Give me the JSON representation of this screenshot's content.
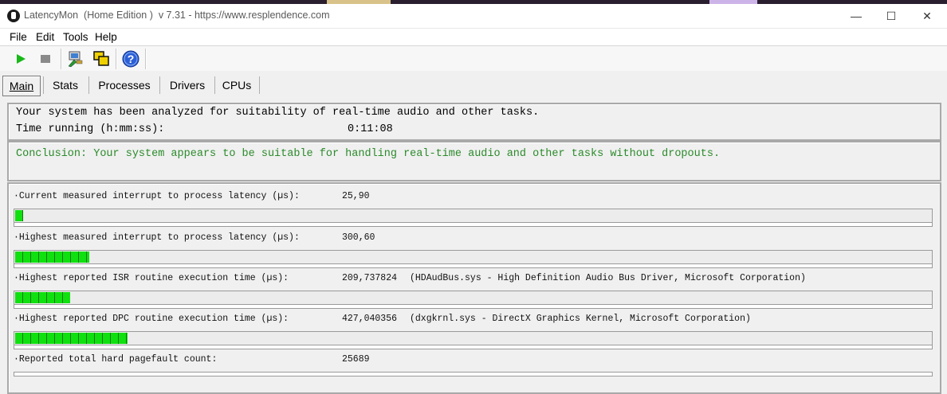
{
  "window": {
    "title": "LatencyMon  (Home Edition )  v 7.31 - https://www.resplendence.com",
    "minimize_glyph": "—",
    "maximize_glyph": "☐",
    "close_glyph": "✕"
  },
  "menu": [
    "File",
    "Edit",
    "Tools",
    "Help"
  ],
  "toolbar": {
    "icons": [
      "play-icon",
      "stop-icon",
      "options-icon",
      "windows-icon",
      "help-icon"
    ]
  },
  "tabs": [
    "Main",
    "Stats",
    "Processes",
    "Drivers",
    "CPUs"
  ],
  "active_tab": "Main",
  "summary": {
    "analysis_text": "Your system has been analyzed for suitability of real-time audio and other tasks.",
    "time_label": "Time running (h:mm:ss):",
    "time_value": "0:11:08"
  },
  "conclusion": "Conclusion: Your system appears to be suitable for handling real-time audio and other tasks without dropouts.",
  "colors": {
    "conclusion_text": "#2b8a2b",
    "bar_fill": "#10e010",
    "bar_segment_separator": "#0a7a0a"
  },
  "metrics": [
    {
      "label": "·Current measured interrupt to process latency (µs):",
      "value": "25,90",
      "extra": "",
      "bar_fraction": 0.0087
    },
    {
      "label": "·Highest measured interrupt to process latency (µs):",
      "value": "300,60",
      "extra": "",
      "bar_fraction": 0.081
    },
    {
      "label": "·Highest reported ISR routine execution time (µs):",
      "value": "209,737824",
      "extra": "(HDAudBus.sys - High Definition Audio Bus Driver, Microsoft Corporation)",
      "bar_fraction": 0.06
    },
    {
      "label": "·Highest reported DPC routine execution time (µs):",
      "value": "427,040356",
      "extra": "(dxgkrnl.sys - DirectX Graphics Kernel, Microsoft Corporation)",
      "bar_fraction": 0.123
    },
    {
      "label": "·Reported total hard pagefault count:",
      "value": "25689",
      "extra": "",
      "bar_fraction": 0
    }
  ]
}
